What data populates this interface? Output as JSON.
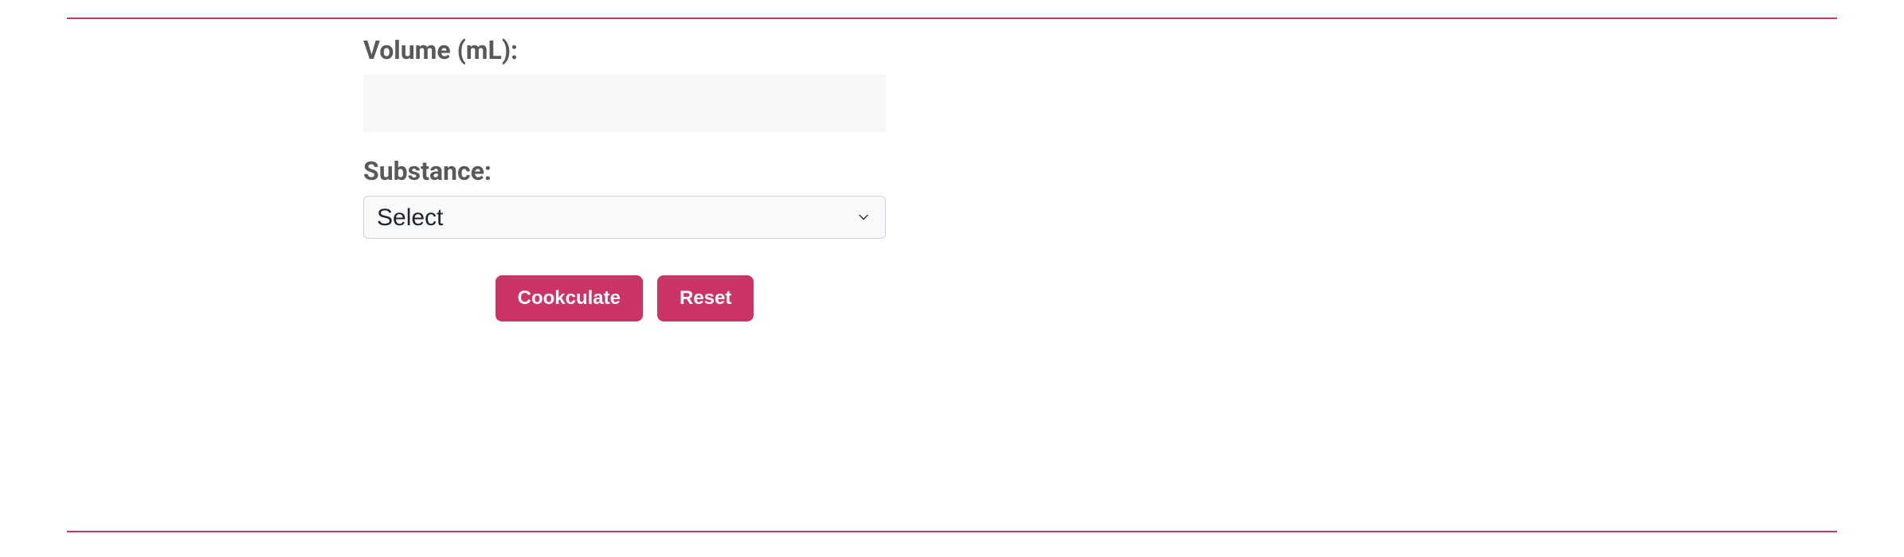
{
  "colors": {
    "accent": "#cc3366",
    "labelText": "#595959",
    "inputBg": "#f6f7f8",
    "selectBg": "#f8f9fa",
    "selectBorder": "#ced4da"
  },
  "form": {
    "volume": {
      "label": "Volume (mL):",
      "value": ""
    },
    "substance": {
      "label": "Substance:",
      "selected": "Select"
    },
    "buttons": {
      "calculate": "Cookculate",
      "reset": "Reset"
    }
  }
}
